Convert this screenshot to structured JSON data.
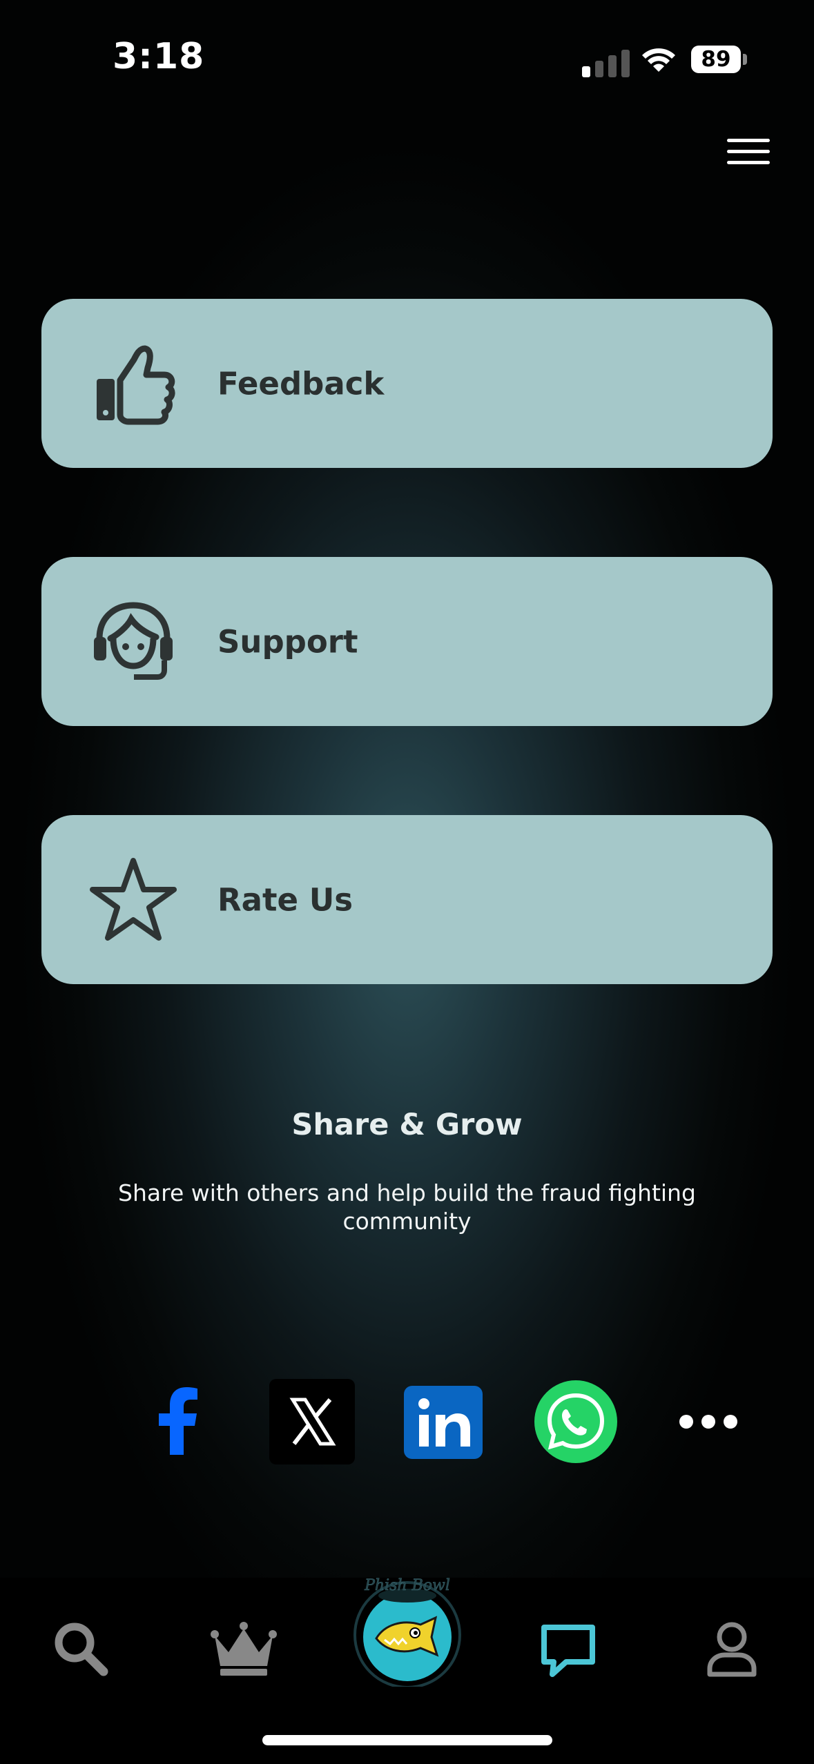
{
  "status_bar": {
    "time": "3:18",
    "battery": "89"
  },
  "header": {
    "menu_icon": "hamburger-menu-icon"
  },
  "actions": [
    {
      "label": "Feedback",
      "icon": "thumbs-up-icon"
    },
    {
      "label": "Support",
      "icon": "headset-agent-icon"
    },
    {
      "label": "Rate Us",
      "icon": "star-icon"
    }
  ],
  "share": {
    "title": "Share & Grow",
    "subtitle": "Share with others and help build the fraud fighting community",
    "networks": [
      "facebook",
      "x",
      "linkedin",
      "whatsapp",
      "more"
    ]
  },
  "bottom_nav": {
    "items": [
      "search",
      "leaderboard",
      "home",
      "chat",
      "profile"
    ],
    "logo_text": "Phish Bowl",
    "active": "chat"
  },
  "colors": {
    "card": "#a5c8c9",
    "accent": "#4cc6d6",
    "facebook": "#0866ff",
    "linkedin": "#0a66c2",
    "whatsapp": "#25d366"
  }
}
